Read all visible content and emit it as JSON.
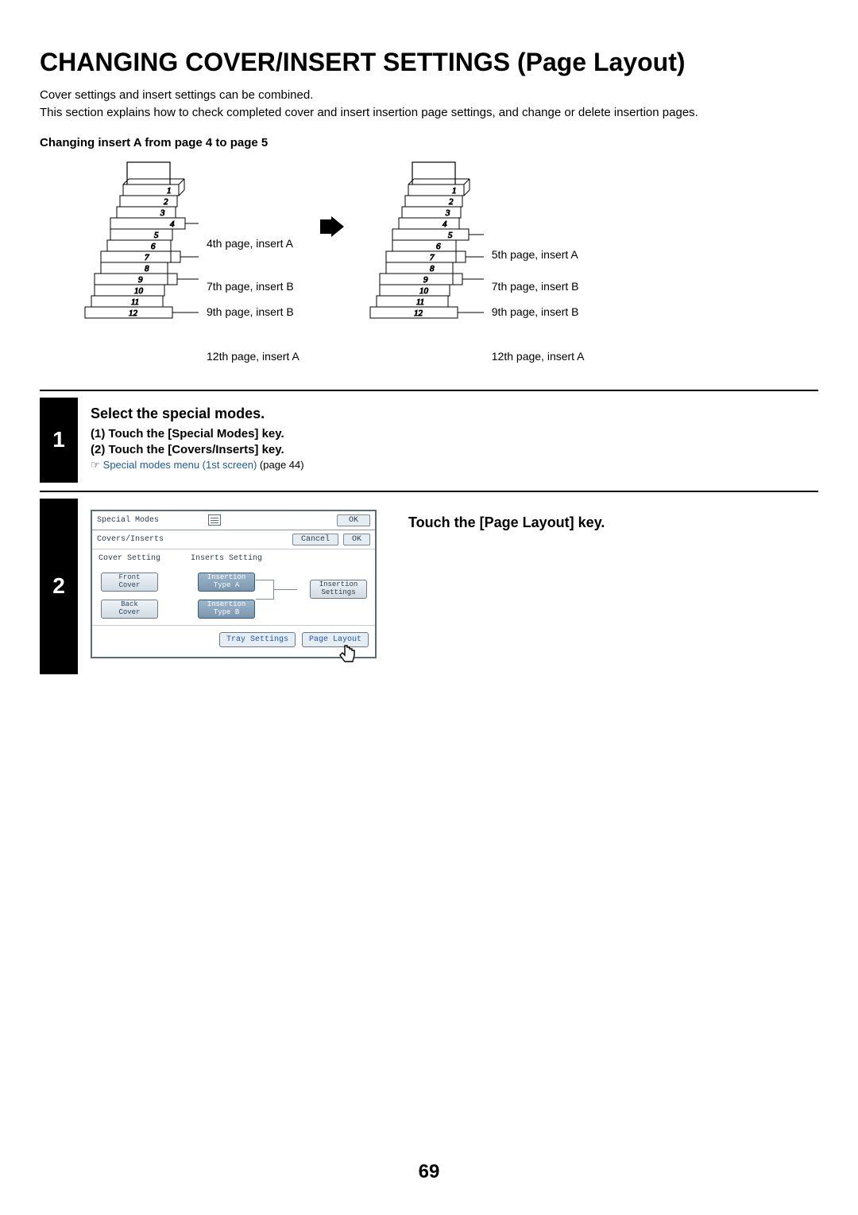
{
  "title": "CHANGING COVER/INSERT SETTINGS (Page Layout)",
  "intro": "Cover settings and insert settings can be combined.\nThis section explains how to check completed cover and insert insertion page settings, and change or delete insertion pages.",
  "example_heading": "Changing insert A from page 4 to page 5",
  "diagram": {
    "left_labels": [
      "4th page, insert A",
      "7th page, insert B",
      "9th page, insert B",
      "12th page, insert A"
    ],
    "right_labels": [
      "5th page, insert A",
      "7th page, insert B",
      "9th page, insert B",
      "12th page, insert A"
    ],
    "left_pages": [
      "1",
      "2",
      "3",
      "4",
      "5",
      "6",
      "7",
      "8",
      "9",
      "10",
      "11",
      "12"
    ],
    "right_pages": [
      "1",
      "2",
      "3",
      "4",
      "5",
      "6",
      "7",
      "8",
      "9",
      "10",
      "11",
      "12"
    ]
  },
  "step1": {
    "num": "1",
    "title": "Select the special modes.",
    "sub1": "(1)  Touch the [Special Modes] key.",
    "sub2": "(2)  Touch the [Covers/Inserts] key.",
    "link_icon": "☞",
    "link_text": "Special modes menu (1st screen)",
    "link_suffix": " (page 44)"
  },
  "step2": {
    "num": "2",
    "right_title": "Touch the [Page Layout] key.",
    "panel": {
      "top_title": "Special Modes",
      "top_ok": "OK",
      "sec_title": "Covers/Inserts",
      "cancel": "Cancel",
      "sec_ok": "OK",
      "cover_setting": "Cover Setting",
      "inserts_setting": "Inserts Setting",
      "front_cover_l1": "Front",
      "front_cover_l2": "Cover",
      "back_cover_l1": "Back",
      "back_cover_l2": "Cover",
      "ins_a_l1": "Insertion",
      "ins_a_l2": "Type A",
      "ins_b_l1": "Insertion",
      "ins_b_l2": "Type B",
      "ins_set_l1": "Insertion",
      "ins_set_l2": "Settings",
      "tray": "Tray Settings",
      "page_layout": "Page Layout"
    }
  },
  "page_number": "69"
}
